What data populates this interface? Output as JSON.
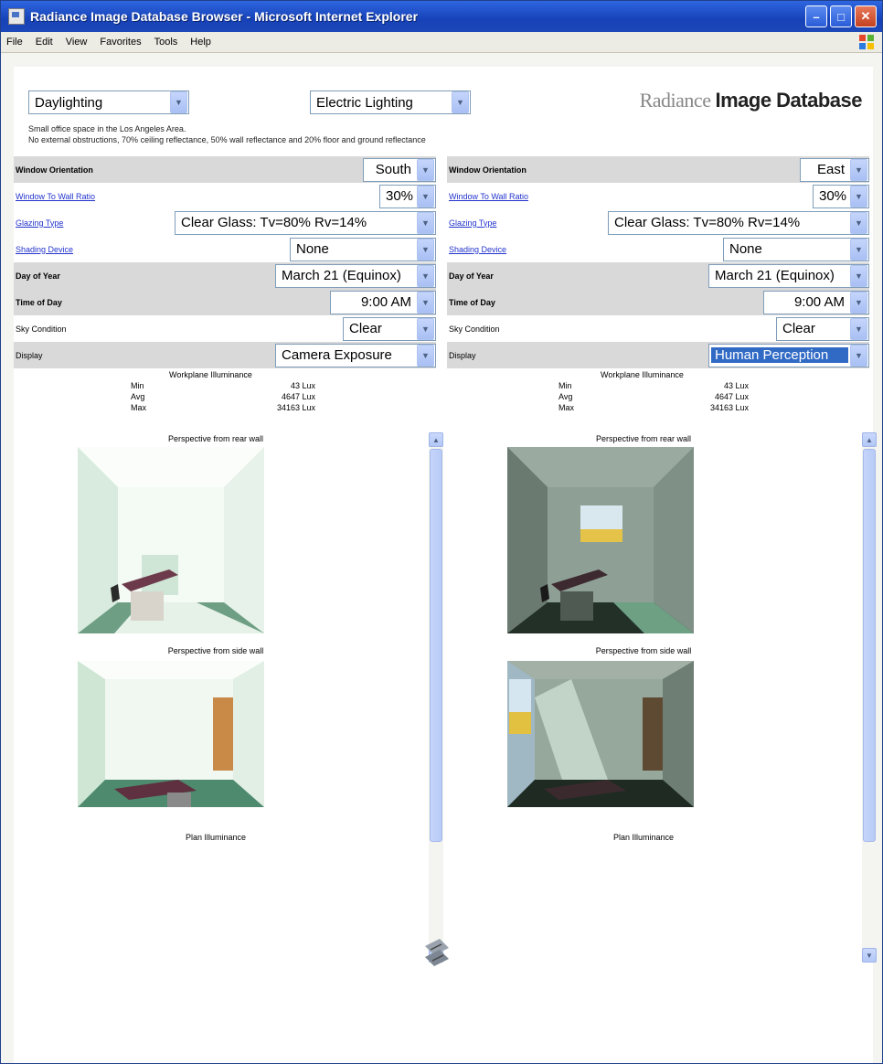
{
  "window": {
    "title": "Radiance Image Database Browser - Microsoft Internet Explorer"
  },
  "menu": [
    "File",
    "Edit",
    "View",
    "Favorites",
    "Tools",
    "Help"
  ],
  "header": {
    "topic_left": "Daylighting",
    "topic_right": "Electric Lighting",
    "logo_light": "Radiance ",
    "logo_bold": "Image Database",
    "desc_line1": "Small office space in the Los Angeles Area.",
    "desc_line2": "No external obstructions, 70% ceiling reflectance, 50% wall reflectance and 20% floor and ground reflectance"
  },
  "left": {
    "rows": [
      {
        "label": "Window Orientation",
        "value": "South"
      },
      {
        "label": "Window To Wall Ratio",
        "value": "30%"
      },
      {
        "label": "Glazing Type",
        "value": "Clear Glass: Tv=80% Rv=14%"
      },
      {
        "label": "Shading Device",
        "value": "None"
      },
      {
        "label": "Day of Year",
        "value": "March 21 (Equinox)"
      },
      {
        "label": "Time of Day",
        "value": "9:00 AM"
      },
      {
        "label": "Sky Condition",
        "value": "Clear"
      },
      {
        "label": "Display",
        "value": "Camera Exposure"
      }
    ],
    "stats": {
      "heading": "Workplane Illuminance",
      "min": "43 Lux",
      "avg": "4647 Lux",
      "max": "34163 Lux"
    },
    "captions": {
      "rear": "Perspective from rear wall",
      "side": "Perspective from side wall",
      "plan": "Plan Illuminance"
    }
  },
  "right": {
    "rows": [
      {
        "label": "Window Orientation",
        "value": "East"
      },
      {
        "label": "Window To Wall Ratio",
        "value": "30%"
      },
      {
        "label": "Glazing Type",
        "value": "Clear Glass: Tv=80% Rv=14%"
      },
      {
        "label": "Shading Device",
        "value": "None"
      },
      {
        "label": "Day of Year",
        "value": "March 21 (Equinox)"
      },
      {
        "label": "Time of Day",
        "value": "9:00 AM"
      },
      {
        "label": "Sky Condition",
        "value": "Clear"
      },
      {
        "label": "Display",
        "value": "Human Perception"
      }
    ],
    "stats": {
      "heading": "Workplane Illuminance",
      "min": "43 Lux",
      "avg": "4647 Lux",
      "max": "34163 Lux"
    },
    "captions": {
      "rear": "Perspective from rear wall",
      "side": "Perspective from side wall",
      "plan": "Plan Illuminance"
    }
  },
  "stat_labels": {
    "min": "Min",
    "avg": "Avg",
    "max": "Max"
  },
  "colors": {
    "titlebar": "#1f4fc8",
    "link": "#2233cc",
    "row_shade": "#d9d9d9",
    "selected": "#316ac5"
  }
}
